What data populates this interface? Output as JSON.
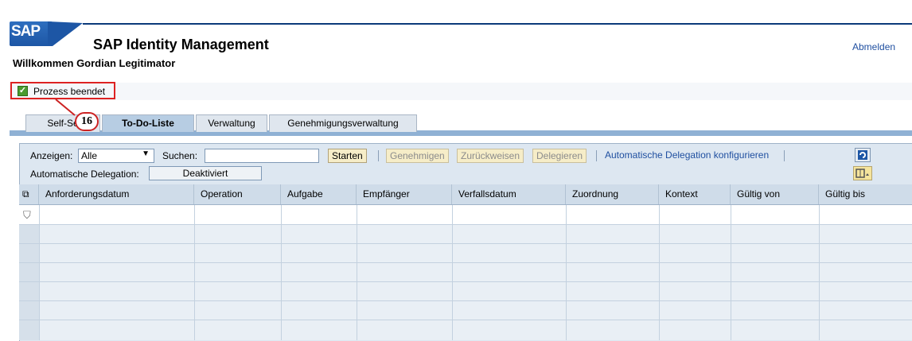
{
  "header": {
    "logo_text": "SAP",
    "app_title": "SAP Identity Management",
    "welcome": "Willkommen Gordian Legitimator",
    "logout": "Abmelden"
  },
  "status": {
    "text": "Prozess beendet",
    "callout_number": "16"
  },
  "tabs": [
    {
      "label": "Self-Se"
    },
    {
      "label": "To-Do-Liste",
      "active": true
    },
    {
      "label": "Verwaltung"
    },
    {
      "label": "Genehmigungsverwaltung"
    }
  ],
  "toolbar": {
    "show_label": "Anzeigen:",
    "show_value": "Alle",
    "search_label": "Suchen:",
    "search_value": "",
    "start": "Starten",
    "approve": "Genehmigen",
    "reject": "Zurückweisen",
    "delegate": "Delegieren",
    "auto_delegation_link": "Automatische Delegation konfigurieren",
    "auto_delegation_label": "Automatische Delegation:",
    "auto_delegation_value": "Deaktiviert"
  },
  "table": {
    "columns": [
      "Anforderungsdatum",
      "Operation",
      "Aufgabe",
      "Empfänger",
      "Verfallsdatum",
      "Zuordnung",
      "Kontext",
      "Gültig von",
      "Gültig bis"
    ]
  },
  "colors": {
    "brand_blue": "#1d56a5",
    "highlight_red": "#d22",
    "panel_bg": "#dde7f1"
  }
}
